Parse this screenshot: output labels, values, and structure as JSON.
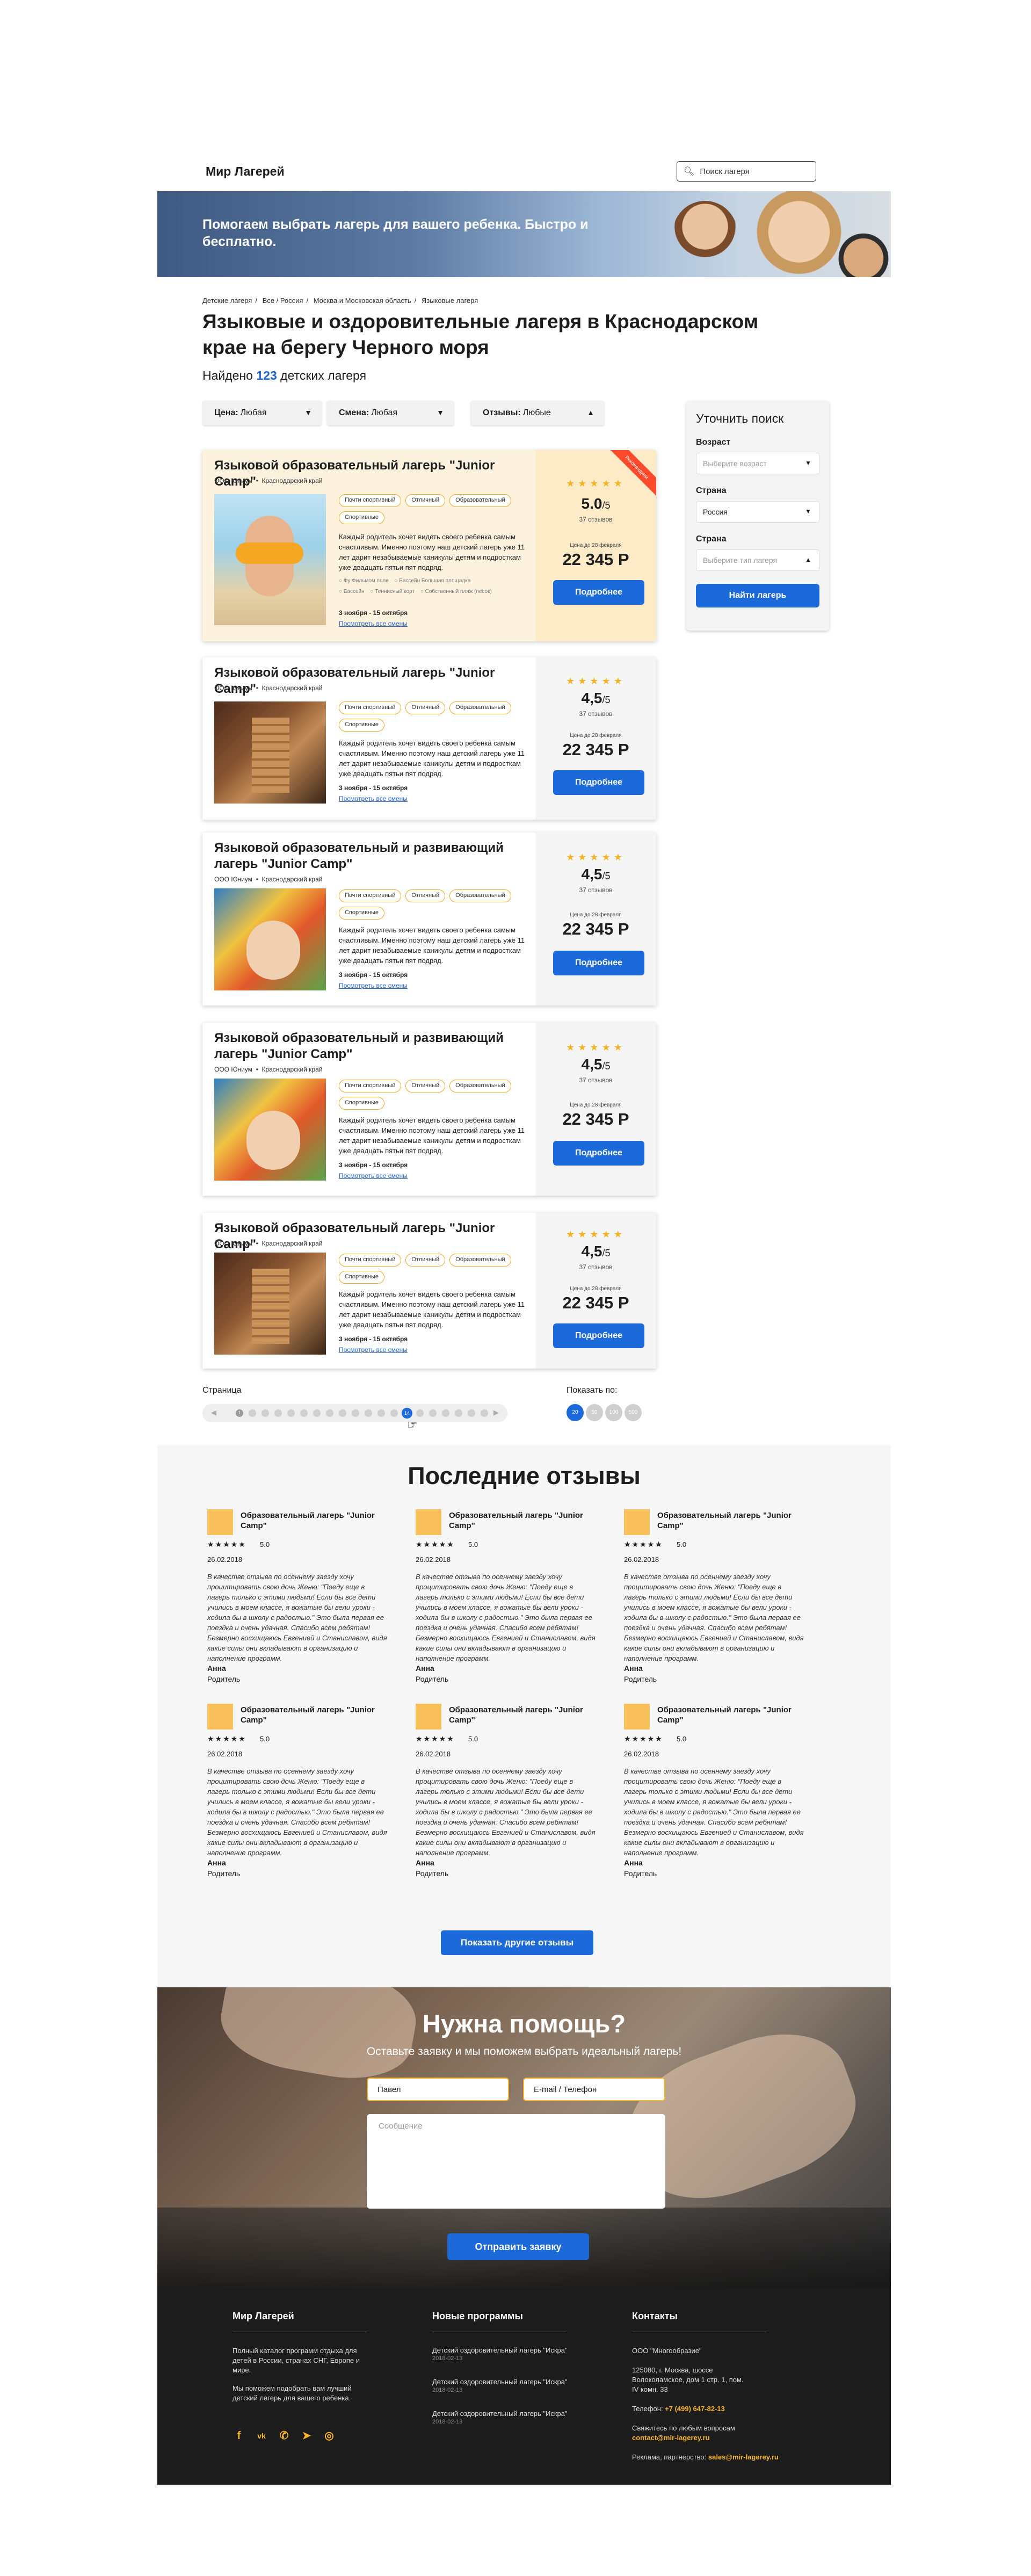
{
  "header": {
    "logo": "Мир Лагерей",
    "search_placeholder": "Поиск лагеря"
  },
  "hero": {
    "title": "Помогаем выбрать лагерь для вашего ребенка. Быстро и бесплатно."
  },
  "breadcrumb": [
    "Детские лагеря",
    "Все / Россия",
    "Москва и Московская область",
    "Языковые лагеря"
  ],
  "page_title": "Языковые и оздоровительные лагеря в Краснодарском крае на берегу Черного моря",
  "found": {
    "prefix": "Найдено",
    "count": "123",
    "suffix": "детских лагеря"
  },
  "filters": [
    {
      "label": "Цена:",
      "value": "Любая"
    },
    {
      "label": "Смена:",
      "value": "Любая"
    },
    {
      "label": "Отзывы:",
      "value": "Любые"
    }
  ],
  "sidebar": {
    "title": "Уточнить поиск",
    "age_label": "Возраст",
    "age_placeholder": "Выберите возраст",
    "country_label": "Страна",
    "country_value": "Россия",
    "type_label": "Страна",
    "type_placeholder": "Выберите тип лагеря",
    "button": "Найти лагерь"
  },
  "cards": [
    {
      "title": "Языковой  образовательный лагерь \"Junior Camp\"",
      "org": "ООО Юниум",
      "region": "Краснодарский край",
      "tags": [
        "Почти спортивный",
        "Отличный",
        "Образовательный",
        "Спортивные"
      ],
      "desc": "Каждый родитель хочет видеть своего ребенка самым счастливым. Именно поэтому наш детский лагерь уже 11 лет дарит незабываемые каникулы детям и подросткам уже двадцать пятьи пят подряд.",
      "options": [
        "Фу Фильмом поле",
        "Бассейн Большая площадка",
        "Бассейн",
        "Теннисный корт",
        "Собственный пляж (песок)"
      ],
      "dates": "3 ноября - 15 октября",
      "shifts_link": "Посмотреть все смены",
      "stars": "★★★★★",
      "rating": "5.0",
      "rating_of": "/5",
      "reviews": "37 отзывов",
      "price_label": "Цена до 28 февраля",
      "price": "22 345 Р",
      "button": "Подробнее",
      "ribbon": "Рекомендуем"
    },
    {
      "title": "Языковой  образовательный лагерь \"Junior Camp\"",
      "org": "ООО Юниум",
      "region": "Краснодарский край",
      "tags": [
        "Почти спортивный",
        "Отличный",
        "Образовательный",
        "Спортивные"
      ],
      "desc": "Каждый родитель хочет видеть своего ребенка самым счастливым. Именно поэтому наш детский лагерь уже 11 лет дарит незабываемые каникулы детям и подросткам уже двадцать пятьи пят подряд.",
      "dates": "3 ноября - 15 октября",
      "shifts_link": "Посмотреть все смены",
      "stars": "★★★★★",
      "rating": "4,5",
      "rating_of": "/5",
      "reviews": "37 отзывов",
      "price_label": "Цена до 28 февраля",
      "price": "22 345 Р",
      "button": "Подробнее"
    },
    {
      "title": "Языковой образовательный и развивающий лагерь \"Junior Camp\"",
      "org": "ООО Юниум",
      "region": "Краснодарский край",
      "tags": [
        "Почти спортивный",
        "Отличный",
        "Образовательный",
        "Спортивные"
      ],
      "desc": "Каждый родитель хочет видеть своего ребенка самым счастливым. Именно поэтому наш детский лагерь уже 11 лет дарит незабываемые каникулы детям и подросткам уже двадцать пятьи пят подряд.",
      "dates": "3 ноября - 15 октября",
      "shifts_link": "Посмотреть все смены",
      "stars": "★★★★★",
      "rating": "4,5",
      "rating_of": "/5",
      "reviews": "37 отзывов",
      "price_label": "Цена до 28 февраля",
      "price": "22 345 Р",
      "button": "Подробнее"
    },
    {
      "title": "Языковой образовательный и развивающий лагерь \"Junior Camp\"",
      "org": "ООО Юниум",
      "region": "Краснодарский край",
      "tags": [
        "Почти спортивный",
        "Отличный",
        "Образовательный",
        "Спортивные"
      ],
      "desc": "Каждый родитель хочет видеть своего ребенка самым счастливым. Именно поэтому наш детский лагерь уже 11 лет дарит незабываемые каникулы детям и подросткам уже двадцать пятьи пят подряд.",
      "dates": "3 ноября - 15 октября",
      "shifts_link": "Посмотреть все смены",
      "stars": "★★★★★",
      "rating": "4,5",
      "rating_of": "/5",
      "reviews": "37 отзывов",
      "price_label": "Цена до 28 февраля",
      "price": "22 345 Р",
      "button": "Подробнее"
    },
    {
      "title": "Языковой образовательный лагерь \"Junior Camp\"",
      "org": "ООО Юниум",
      "region": "Краснодарский край",
      "tags": [
        "Почти спортивный",
        "Отличный",
        "Образовательный",
        "Спортивные"
      ],
      "desc": "Каждый родитель хочет видеть своего ребенка самым счастливым. Именно поэтому наш детский лагерь уже 11 лет дарит незабываемые каникулы детям и подросткам уже двадцать пятьи пят подряд.",
      "dates": "3 ноября - 15 октября",
      "shifts_link": "Посмотреть все смены",
      "stars": "★★★★★",
      "rating": "4,5",
      "rating_of": "/5",
      "reviews": "37 отзывов",
      "price_label": "Цена до 28 февраля",
      "price": "22 345 Р",
      "button": "Подробнее"
    }
  ],
  "pagination": {
    "label": "Страница",
    "prev": "◀",
    "next": "▶",
    "first_number": "1",
    "current": "14",
    "current_index": 13,
    "per_page_label": "Показать по:",
    "per_page": [
      "20",
      "50",
      "100",
      "500"
    ],
    "per_page_active": "20"
  },
  "reviews_section": {
    "title": "Последние отзывы",
    "items": [
      {
        "camp": "Образовательный лагерь \"Junior Camp\"",
        "stars": "★★★★★",
        "score": "5.0",
        "date": "26.02.2018",
        "text": "В качестве отзыва по осеннему заезду хочу процитировать свою дочь Женю: \"Поеду еще в лагерь только с этими людьми! Если бы все дети учились в моем классе, я вожатые бы вели уроки - ходила бы в школу с радостью.\" Это была первая ее поездка и очень удачная. Спасибо всем ребятам! Безмерно восхищаюсь Евгенией и Станиславом, видя какие силы они вкладывают в организацию и наполнение программ.",
        "author": "Анна",
        "role": "Родитель"
      },
      {
        "camp": "Образовательный лагерь \"Junior Camp\"",
        "stars": "★★★★★",
        "score": "5.0",
        "date": "26.02.2018",
        "text": "В качестве отзыва по осеннему заезду хочу процитировать свою дочь Женю: \"Поеду еще в лагерь только с этими людьми! Если бы все дети учились в моем классе, я вожатые бы вели уроки - ходила бы в школу с радостью.\" Это была первая ее поездка и очень удачная. Спасибо всем ребятам! Безмерно восхищаюсь Евгенией и Станиславом, видя какие силы они вкладывают в организацию и наполнение программ.",
        "author": "Анна",
        "role": "Родитель"
      },
      {
        "camp": "Образовательный лагерь \"Junior Camp\"",
        "stars": "★★★★★",
        "score": "5.0",
        "date": "26.02.2018",
        "text": "В качестве отзыва по осеннему заезду хочу процитировать свою дочь Женю: \"Поеду еще в лагерь только с этими людьми! Если бы все дети учились в моем классе, я вожатые бы вели уроки - ходила бы в школу с радостью.\" Это была первая ее поездка и очень удачная. Спасибо всем ребятам! Безмерно восхищаюсь Евгенией и Станиславом, видя какие силы они вкладывают в организацию и наполнение программ.",
        "author": "Анна",
        "role": "Родитель"
      },
      {
        "camp": "Образовательный лагерь \"Junior Camp\"",
        "stars": "★★★★★",
        "score": "5.0",
        "date": "26.02.2018",
        "text": "В качестве отзыва по осеннему заезду хочу процитировать свою дочь Женю: \"Поеду еще в лагерь только с этими людьми! Если бы все дети учились в моем классе, я вожатые бы вели уроки - ходила бы в школу с радостью.\" Это была первая ее поездка и очень удачная. Спасибо всем ребятам! Безмерно восхищаюсь Евгенией и Станиславом, видя какие силы они вкладывают в организацию и наполнение программ.",
        "author": "Анна",
        "role": "Родитель"
      },
      {
        "camp": "Образовательный лагерь \"Junior Camp\"",
        "stars": "★★★★★",
        "score": "5.0",
        "date": "26.02.2018",
        "text": "В качестве отзыва по осеннему заезду хочу процитировать свою дочь Женю: \"Поеду еще в лагерь только с этими людьми! Если бы все дети учились в моем классе, я вожатые бы вели уроки - ходила бы в школу с радостью.\" Это была первая ее поездка и очень удачная. Спасибо всем ребятам! Безмерно восхищаюсь Евгенией и Станиславом, видя какие силы они вкладывают в организацию и наполнение программ.",
        "author": "Анна",
        "role": "Родитель"
      },
      {
        "camp": "Образовательный лагерь \"Junior Camp\"",
        "stars": "★★★★★",
        "score": "5.0",
        "date": "26.02.2018",
        "text": "В качестве отзыва по осеннему заезду хочу процитировать свою дочь Женю: \"Поеду еще в лагерь только с этими людьми! Если бы все дети учились в моем классе, я вожатые бы вели уроки - ходила бы в школу с радостью.\" Это была первая ее поездка и очень удачная. Спасибо всем ребятам! Безмерно восхищаюсь Евгенией и Станиславом, видя какие силы они вкладывают в организацию и наполнение программ.",
        "author": "Анна",
        "role": "Родитель"
      }
    ],
    "more_button": "Показать другие отзывы"
  },
  "help": {
    "title": "Нужна помощь?",
    "subtitle": "Оставьте заявку и мы поможем выбрать идеальный лагерь!",
    "name_value": "Павел",
    "contact_value": "E-mail / Телефон",
    "message_placeholder": "Сообщение",
    "send_button": "Отправить заявку"
  },
  "footer": {
    "about": {
      "title": "Мир Лагерей",
      "p1": "Полный каталог программ отдыха для детей в России, странах СНГ, Европе и мире.",
      "p2": "Мы поможем подобрать вам лучший детский лагерь для вашего ребенка."
    },
    "programs": {
      "title": "Новые программы",
      "items": [
        {
          "name": "Детский оздоровительный лагерь \"Искра\"",
          "date": "2018-02-13"
        },
        {
          "name": "Детский оздоровительный лагерь \"Искра\"",
          "date": "2018-02-13"
        },
        {
          "name": "Детский оздоровительный лагерь \"Искра\"",
          "date": "2018-02-13"
        }
      ]
    },
    "contacts": {
      "title": "Контакты",
      "company": "ООО \"Многообразие\"",
      "address": "125080, г. Москва, шоссе Волоколамское, дом 1 стр. 1, пом. IV комн. 33",
      "phone_label": "Телефон:",
      "phone": "+7 (499) 647-82-13",
      "email_label": "Свяжитесь по любым вопросам",
      "email": "contact@mir-lagerey.ru",
      "ads_label": "Реклама, партнерство:",
      "ads_email": "sales@mir-lagerey.ru"
    },
    "socials": [
      "facebook-icon",
      "vk-icon",
      "phone-icon",
      "telegram-icon",
      "whatsapp-icon"
    ],
    "social_glyphs": [
      "f",
      "vk",
      "✆",
      "➤",
      "◎"
    ]
  },
  "colors": {
    "accent": "#1c6ad9",
    "tag_border": "#f2a81d",
    "star": "#f5b324",
    "featured_bg": "#fdf2dd"
  }
}
